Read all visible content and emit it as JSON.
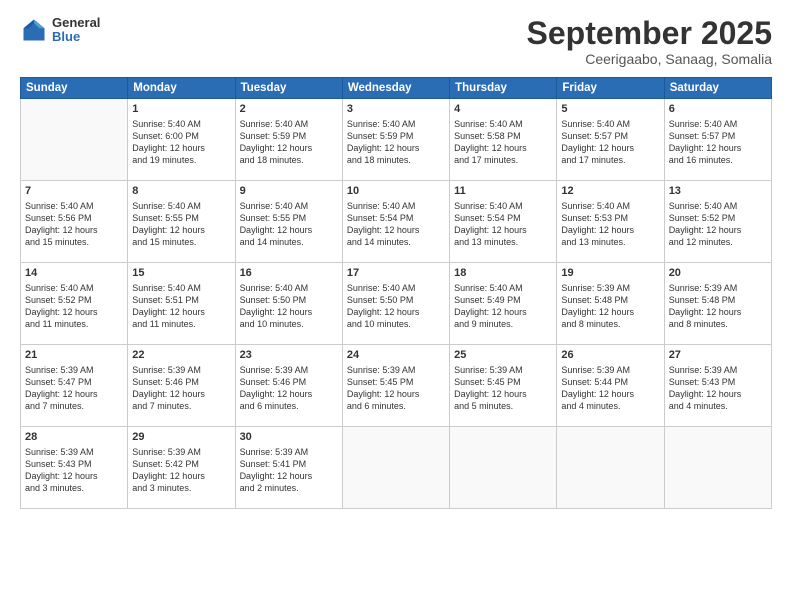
{
  "logo": {
    "general": "General",
    "blue": "Blue"
  },
  "header": {
    "month": "September 2025",
    "location": "Ceerigaabo, Sanaag, Somalia"
  },
  "days": [
    "Sunday",
    "Monday",
    "Tuesday",
    "Wednesday",
    "Thursday",
    "Friday",
    "Saturday"
  ],
  "weeks": [
    [
      {
        "day": "",
        "data": ""
      },
      {
        "day": "1",
        "data": "Sunrise: 5:40 AM\nSunset: 6:00 PM\nDaylight: 12 hours\nand 19 minutes."
      },
      {
        "day": "2",
        "data": "Sunrise: 5:40 AM\nSunset: 5:59 PM\nDaylight: 12 hours\nand 18 minutes."
      },
      {
        "day": "3",
        "data": "Sunrise: 5:40 AM\nSunset: 5:59 PM\nDaylight: 12 hours\nand 18 minutes."
      },
      {
        "day": "4",
        "data": "Sunrise: 5:40 AM\nSunset: 5:58 PM\nDaylight: 12 hours\nand 17 minutes."
      },
      {
        "day": "5",
        "data": "Sunrise: 5:40 AM\nSunset: 5:57 PM\nDaylight: 12 hours\nand 17 minutes."
      },
      {
        "day": "6",
        "data": "Sunrise: 5:40 AM\nSunset: 5:57 PM\nDaylight: 12 hours\nand 16 minutes."
      }
    ],
    [
      {
        "day": "7",
        "data": "Sunrise: 5:40 AM\nSunset: 5:56 PM\nDaylight: 12 hours\nand 15 minutes."
      },
      {
        "day": "8",
        "data": "Sunrise: 5:40 AM\nSunset: 5:55 PM\nDaylight: 12 hours\nand 15 minutes."
      },
      {
        "day": "9",
        "data": "Sunrise: 5:40 AM\nSunset: 5:55 PM\nDaylight: 12 hours\nand 14 minutes."
      },
      {
        "day": "10",
        "data": "Sunrise: 5:40 AM\nSunset: 5:54 PM\nDaylight: 12 hours\nand 14 minutes."
      },
      {
        "day": "11",
        "data": "Sunrise: 5:40 AM\nSunset: 5:54 PM\nDaylight: 12 hours\nand 13 minutes."
      },
      {
        "day": "12",
        "data": "Sunrise: 5:40 AM\nSunset: 5:53 PM\nDaylight: 12 hours\nand 13 minutes."
      },
      {
        "day": "13",
        "data": "Sunrise: 5:40 AM\nSunset: 5:52 PM\nDaylight: 12 hours\nand 12 minutes."
      }
    ],
    [
      {
        "day": "14",
        "data": "Sunrise: 5:40 AM\nSunset: 5:52 PM\nDaylight: 12 hours\nand 11 minutes."
      },
      {
        "day": "15",
        "data": "Sunrise: 5:40 AM\nSunset: 5:51 PM\nDaylight: 12 hours\nand 11 minutes."
      },
      {
        "day": "16",
        "data": "Sunrise: 5:40 AM\nSunset: 5:50 PM\nDaylight: 12 hours\nand 10 minutes."
      },
      {
        "day": "17",
        "data": "Sunrise: 5:40 AM\nSunset: 5:50 PM\nDaylight: 12 hours\nand 10 minutes."
      },
      {
        "day": "18",
        "data": "Sunrise: 5:40 AM\nSunset: 5:49 PM\nDaylight: 12 hours\nand 9 minutes."
      },
      {
        "day": "19",
        "data": "Sunrise: 5:39 AM\nSunset: 5:48 PM\nDaylight: 12 hours\nand 8 minutes."
      },
      {
        "day": "20",
        "data": "Sunrise: 5:39 AM\nSunset: 5:48 PM\nDaylight: 12 hours\nand 8 minutes."
      }
    ],
    [
      {
        "day": "21",
        "data": "Sunrise: 5:39 AM\nSunset: 5:47 PM\nDaylight: 12 hours\nand 7 minutes."
      },
      {
        "day": "22",
        "data": "Sunrise: 5:39 AM\nSunset: 5:46 PM\nDaylight: 12 hours\nand 7 minutes."
      },
      {
        "day": "23",
        "data": "Sunrise: 5:39 AM\nSunset: 5:46 PM\nDaylight: 12 hours\nand 6 minutes."
      },
      {
        "day": "24",
        "data": "Sunrise: 5:39 AM\nSunset: 5:45 PM\nDaylight: 12 hours\nand 6 minutes."
      },
      {
        "day": "25",
        "data": "Sunrise: 5:39 AM\nSunset: 5:45 PM\nDaylight: 12 hours\nand 5 minutes."
      },
      {
        "day": "26",
        "data": "Sunrise: 5:39 AM\nSunset: 5:44 PM\nDaylight: 12 hours\nand 4 minutes."
      },
      {
        "day": "27",
        "data": "Sunrise: 5:39 AM\nSunset: 5:43 PM\nDaylight: 12 hours\nand 4 minutes."
      }
    ],
    [
      {
        "day": "28",
        "data": "Sunrise: 5:39 AM\nSunset: 5:43 PM\nDaylight: 12 hours\nand 3 minutes."
      },
      {
        "day": "29",
        "data": "Sunrise: 5:39 AM\nSunset: 5:42 PM\nDaylight: 12 hours\nand 3 minutes."
      },
      {
        "day": "30",
        "data": "Sunrise: 5:39 AM\nSunset: 5:41 PM\nDaylight: 12 hours\nand 2 minutes."
      },
      {
        "day": "",
        "data": ""
      },
      {
        "day": "",
        "data": ""
      },
      {
        "day": "",
        "data": ""
      },
      {
        "day": "",
        "data": ""
      }
    ]
  ]
}
